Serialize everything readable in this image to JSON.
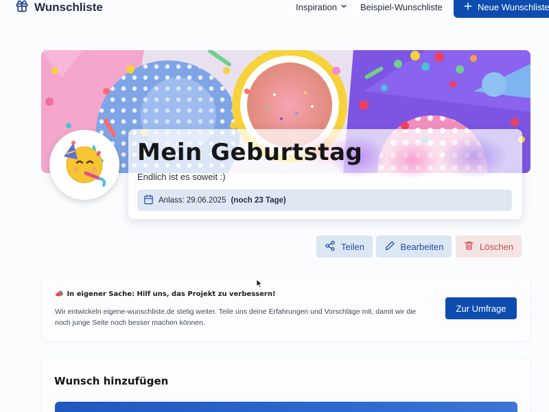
{
  "nav": {
    "brand": "Wunschliste",
    "inspiration": "Inspiration",
    "example_list": "Beispiel-Wunschliste",
    "new_list": "Neue Wunschliste"
  },
  "list": {
    "title": "Mein Geburtstag",
    "subtitle": "Endlich ist es soweit :)",
    "occasion_label": "Anlass: 29.06.2025",
    "occasion_countdown": "(noch 23 Tage)"
  },
  "actions": {
    "share": "Teilen",
    "edit": "Bearbeiten",
    "delete": "Löschen"
  },
  "survey": {
    "emoji": "📣",
    "heading": "In eigener Sache: Hilf uns, das Projekt zu verbessern!",
    "text": "Wir entwickeln eigene-wunschliste.de stetig weiter. Teile uns deine Erfahrungen und Vorschläge mit, damit wir die noch junge Seite noch besser machen können.",
    "button": "Zur Umfrage"
  },
  "add_wish": {
    "title": "Wunsch hinzufügen"
  },
  "colors": {
    "primary": "#0e4db0",
    "secondary_bg": "#dde6f3",
    "danger": "#d24a4a",
    "danger_bg": "#f4e4e4"
  },
  "icons": [
    "gift-icon",
    "chevron-down-icon",
    "plus-icon",
    "calendar-icon",
    "share-icon",
    "pencil-icon",
    "trash-icon",
    "megaphone-icon",
    "party-face-icon",
    "cursor-icon"
  ]
}
